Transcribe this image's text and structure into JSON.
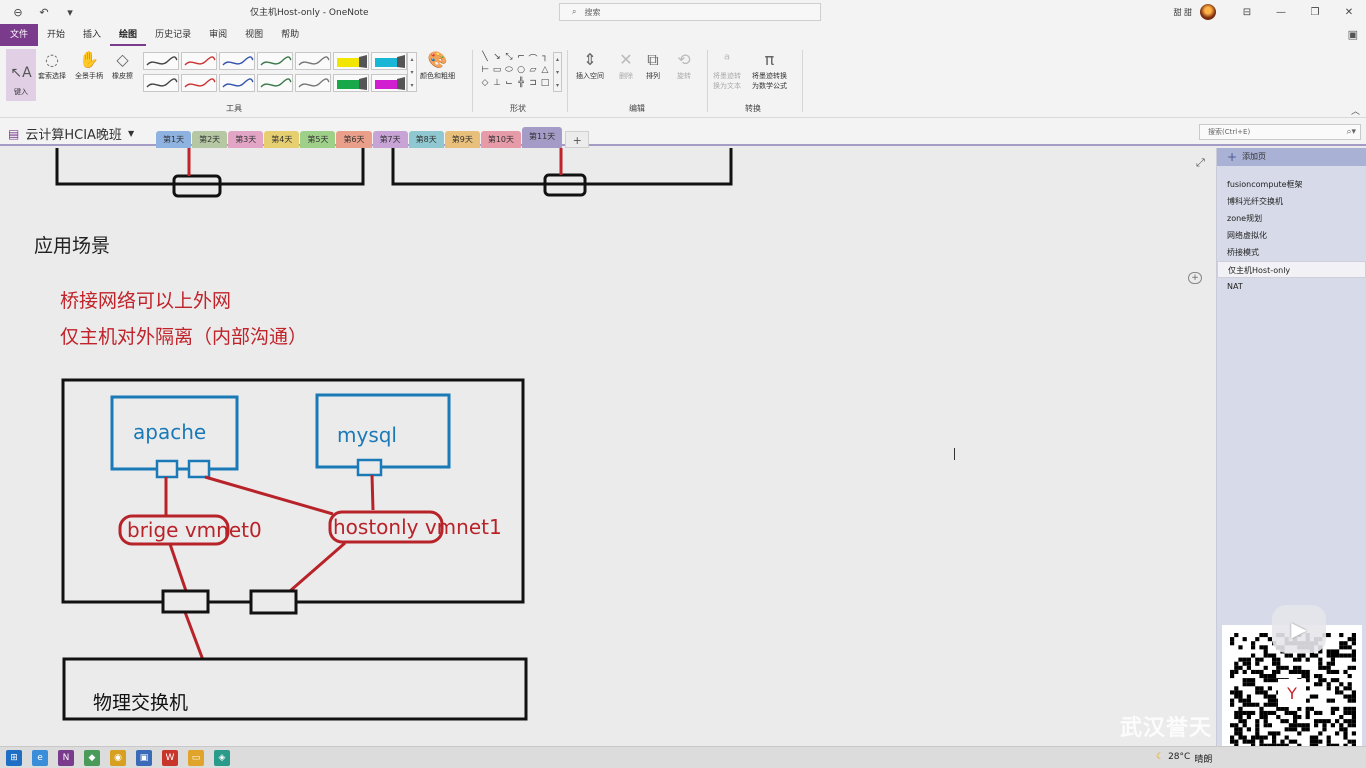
{
  "window": {
    "title": "仅主机Host-only  -  OneNote",
    "search_placeholder": "搜索",
    "user": "甜 甜"
  },
  "menu": {
    "file": "文件",
    "tabs": [
      "开始",
      "插入",
      "绘图",
      "历史记录",
      "审阅",
      "视图",
      "帮助"
    ],
    "active": "绘图"
  },
  "ribbon": {
    "type_label": "键入",
    "lasso_label": "套索选择",
    "pan_label": "全景手柄",
    "eraser_label": "橡皮擦",
    "color_label": "颜色和粗细",
    "tools_group": "工具",
    "shapes_group": "形状",
    "insert_space": "插入空间",
    "delete": "删除",
    "arrange": "排列",
    "rotate": "旋转",
    "edit_group": "编辑",
    "ink_to_text": "将墨迹转换为文本",
    "ink_to_text_line1": "将墨迹转",
    "ink_to_text_line2": "换为文本",
    "ink_to_math_line1": "将墨迹转换",
    "ink_to_math_line2": "为数学公式",
    "convert_group": "转换",
    "pen_colors": [
      "#444444",
      "#cc3333",
      "#3355aa",
      "#3a7a4a",
      "#777777",
      "#f2e600",
      "#19b6d6",
      "#444444",
      "#cc3333",
      "#3355aa",
      "#3a7a4a",
      "#777777",
      "#18a84a",
      "#d11ed1"
    ]
  },
  "notebook": {
    "name": "云计算HCIA晚班",
    "sections": [
      {
        "label": "第1天",
        "color": "#8fb3e0"
      },
      {
        "label": "第2天",
        "color": "#b5c8a3"
      },
      {
        "label": "第3天",
        "color": "#e3a5c6"
      },
      {
        "label": "第4天",
        "color": "#e6cf71"
      },
      {
        "label": "第5天",
        "color": "#9fd08a"
      },
      {
        "label": "第6天",
        "color": "#ea9f8a"
      },
      {
        "label": "第7天",
        "color": "#c8a3d6"
      },
      {
        "label": "第8天",
        "color": "#8fc8d1"
      },
      {
        "label": "第9天",
        "color": "#e9c07b"
      },
      {
        "label": "第10天",
        "color": "#e79aa7"
      },
      {
        "label": "第11天",
        "color": "#a49bc6"
      }
    ],
    "add_section": "+",
    "search_placeholder": "搜索(Ctrl+E)"
  },
  "page": {
    "heading": "应用场景",
    "lines": [
      "桥接网络可以上外网",
      "仅主机对外隔离（内部沟通）"
    ],
    "diagram": {
      "apache": "apache",
      "mysql": "mysql",
      "bridge": "brige vmnet0",
      "hostonly": "hostonly vmnet1",
      "switch": "物理交换机"
    }
  },
  "pages_panel": {
    "add_page": "添加页",
    "items": [
      "fusioncompute框架",
      "博科光纤交换机",
      "zone规划",
      "网络虚拟化",
      "桥接模式",
      "仅主机Host-only",
      "NAT"
    ],
    "selected_index": 5
  },
  "taskbar": {
    "weather": "28°C",
    "weather_desc": "晴朗"
  },
  "overlay": {
    "watermark": "武汉誉天"
  }
}
